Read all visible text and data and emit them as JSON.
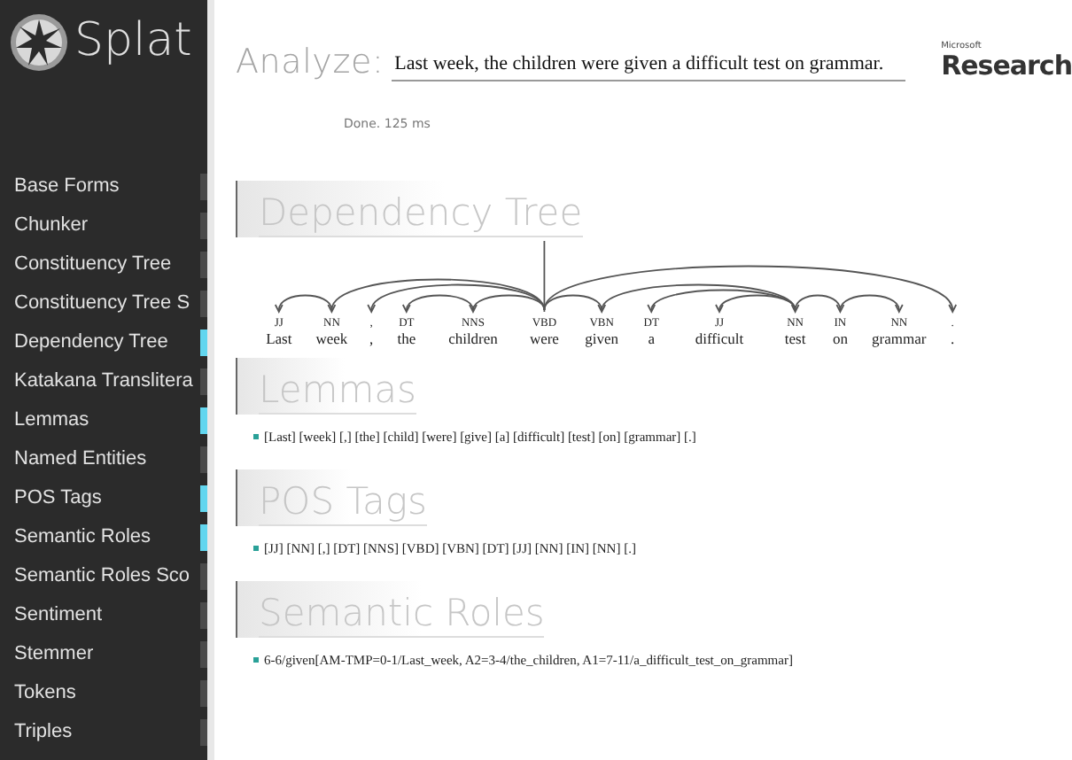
{
  "app": {
    "name": "Splat"
  },
  "sidebar": {
    "items": [
      {
        "label": "Base Forms",
        "selected": false
      },
      {
        "label": "Chunker",
        "selected": false
      },
      {
        "label": "Constituency Tree",
        "selected": false
      },
      {
        "label": "Constituency Tree S",
        "selected": false
      },
      {
        "label": "Dependency Tree",
        "selected": true
      },
      {
        "label": "Katakana Translitera",
        "selected": false
      },
      {
        "label": "Lemmas",
        "selected": true
      },
      {
        "label": "Named Entities",
        "selected": false
      },
      {
        "label": "POS Tags",
        "selected": true
      },
      {
        "label": "Semantic Roles",
        "selected": true
      },
      {
        "label": "Semantic Roles Sco",
        "selected": false
      },
      {
        "label": "Sentiment",
        "selected": false
      },
      {
        "label": "Stemmer",
        "selected": false
      },
      {
        "label": "Tokens",
        "selected": false
      },
      {
        "label": "Triples",
        "selected": false
      }
    ]
  },
  "analyze": {
    "label": "Analyze:",
    "value": "Last week, the children were given a difficult test on grammar."
  },
  "brand": {
    "small": "Microsoft",
    "large": "Research"
  },
  "status": "Done. 125 ms",
  "sections": [
    {
      "kind": "tree",
      "title": "Dependency Tree",
      "tokens": [
        {
          "tag": "JJ",
          "word": "Last"
        },
        {
          "tag": "NN",
          "word": "week"
        },
        {
          "tag": ",",
          "word": ","
        },
        {
          "tag": "DT",
          "word": "the"
        },
        {
          "tag": "NNS",
          "word": "children"
        },
        {
          "tag": "VBD",
          "word": "were"
        },
        {
          "tag": "VBN",
          "word": "given"
        },
        {
          "tag": "DT",
          "word": "a"
        },
        {
          "tag": "JJ",
          "word": "difficult"
        },
        {
          "tag": "NN",
          "word": "test"
        },
        {
          "tag": "IN",
          "word": "on"
        },
        {
          "tag": "NN",
          "word": "grammar"
        },
        {
          "tag": ".",
          "word": "."
        }
      ]
    },
    {
      "kind": "line",
      "title": "Lemmas",
      "text": "[Last] [week] [,] [the] [child] [were] [give] [a] [difficult] [test] [on] [grammar] [.]"
    },
    {
      "kind": "line",
      "title": "POS Tags",
      "text": "[JJ] [NN] [,] [DT] [NNS] [VBD] [VBN] [DT] [JJ] [NN] [IN] [NN] [.]"
    },
    {
      "kind": "line",
      "title": "Semantic Roles",
      "text": "6-6/given[AM-TMP=0-1/Last_week, A2=3-4/the_children, A1=7-11/a_difficult_test_on_grammar]"
    }
  ]
}
